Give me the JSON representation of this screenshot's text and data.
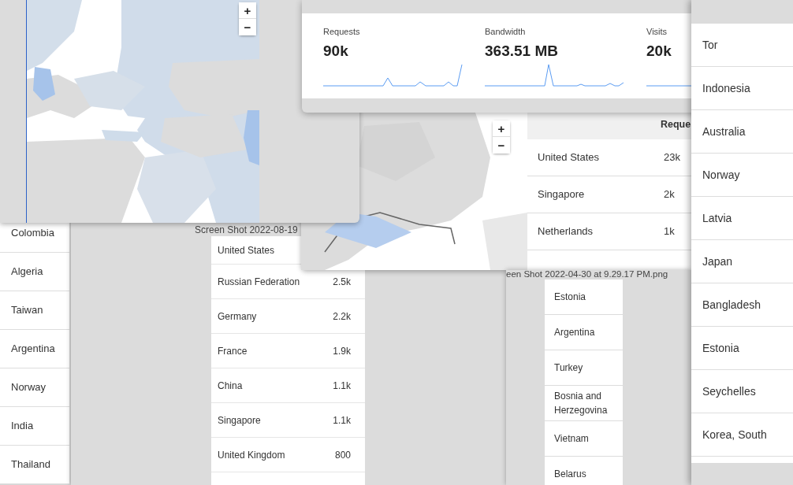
{
  "country_list_left": {
    "rows": [
      "Colombia",
      "Algeria",
      "Taiwan",
      "Argentina",
      "Norway",
      "India",
      "Thailand"
    ]
  },
  "screenshot_window": {
    "caption": "Screen Shot 2022-08-19",
    "rows": [
      {
        "country": "United States"
      },
      {
        "country": "Russian Federation",
        "value": "2.5k"
      },
      {
        "country": "Germany",
        "value": "2.2k"
      },
      {
        "country": "France",
        "value": "1.9k"
      },
      {
        "country": "China",
        "value": "1.1k"
      },
      {
        "country": "Singapore",
        "value": "1.1k"
      },
      {
        "country": "United Kingdom",
        "value": "800"
      }
    ]
  },
  "singapore_window": {
    "zoom_buttons": [
      "+",
      "−"
    ],
    "table": {
      "header": "Reque",
      "rows": [
        {
          "country": "United States",
          "value": "23k"
        },
        {
          "country": "Singapore",
          "value": "2k"
        },
        {
          "country": "Netherlands",
          "value": "1k"
        }
      ]
    }
  },
  "screenshot_window_2": {
    "caption": "een Shot 2022-04-30 at 9.29.17 PM.png",
    "rows": [
      "Estonia",
      "Argentina",
      "Turkey",
      "Bosnia and Herzegovina",
      "Vietnam",
      "Belarus"
    ]
  },
  "europe_map_window": {
    "zoom_buttons": [
      "+",
      "−"
    ]
  },
  "stats_window": {
    "stats": [
      {
        "label": "Requests",
        "value": "90k"
      },
      {
        "label": "Bandwidth",
        "value": "363.51 MB"
      },
      {
        "label": "Visits",
        "value": "20k"
      }
    ]
  },
  "country_list_right": {
    "rows": [
      "Tor",
      "Indonesia",
      "Australia",
      "Norway",
      "Latvia",
      "Japan",
      "Bangladesh",
      "Estonia",
      "Seychelles",
      "Korea, South"
    ]
  }
}
